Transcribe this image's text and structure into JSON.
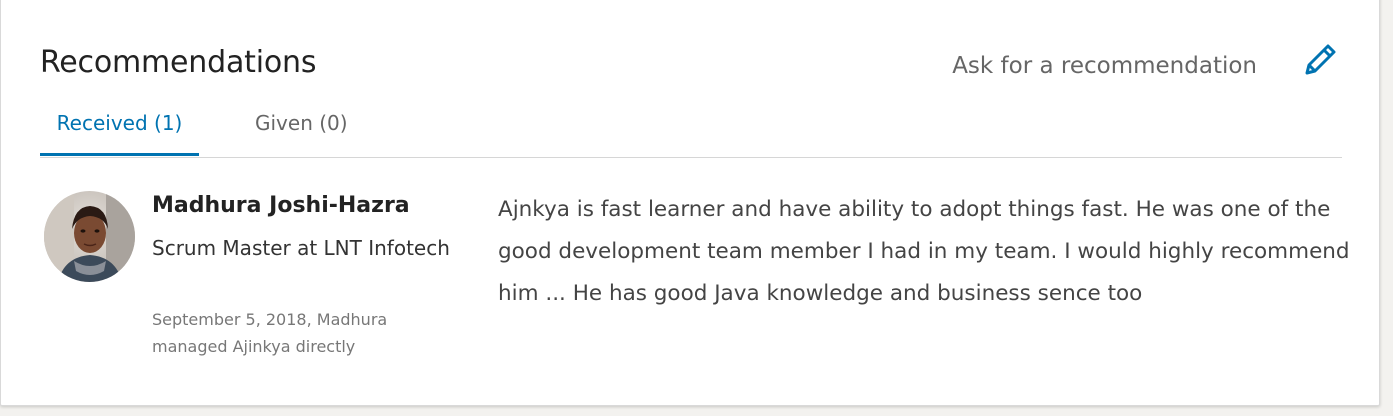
{
  "section": {
    "title": "Recommendations",
    "ask_link": "Ask for a recommendation",
    "edit_icon": "pencil-icon",
    "accent_color": "#0073b1"
  },
  "tabs": [
    {
      "label": "Received (1)",
      "active": true
    },
    {
      "label": "Given (0)",
      "active": false
    }
  ],
  "recommendation": {
    "name": "Madhura Joshi-Hazra",
    "headline": "Scrum Master at LNT Infotech",
    "meta": "September 5, 2018, Madhura managed Ajinkya directly",
    "text": "Ajnkya is fast learner and have ability to adopt things fast. He was one of the good development team member I had in my team. I would highly recommend him ... He has good Java knowledge and business sence too",
    "avatar_icon": "profile-photo"
  }
}
